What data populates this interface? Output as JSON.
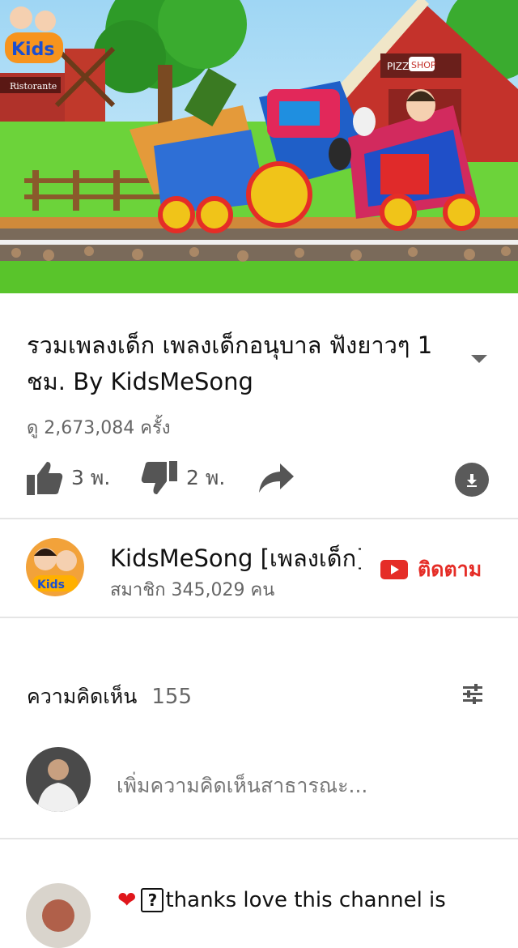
{
  "video": {
    "thumbnail_description": "kids-train-cartoon",
    "signs": {
      "logo_text": "Kids",
      "ristorante": "Ristorante",
      "pizza": "PIZZA",
      "shop": "SHOP"
    }
  },
  "title": {
    "text": "รวมเพลงเด็ก เพลงเด็กอนุบาล ฟังยาวๆ 1 ชม.  By KidsMeSong"
  },
  "views": {
    "text": "ดู 2,673,084 ครั้ง"
  },
  "actions": {
    "like_count": "3 พ.",
    "dislike_count": "2 พ."
  },
  "channel": {
    "name": "KidsMeSong [เพลงเด็ก]",
    "subscribers": "สมาชิก 345,029 คน",
    "subscribe_label": "ติดตาม"
  },
  "comments": {
    "header": "ความคิดเห็น",
    "count": "155",
    "add_placeholder": "เพิ่มความคิดเห็นสาธารณะ...",
    "first": {
      "text": "thanks love this channel is"
    }
  },
  "colors": {
    "accent_red": "#e52d27",
    "divider": "#e5e5e5"
  }
}
